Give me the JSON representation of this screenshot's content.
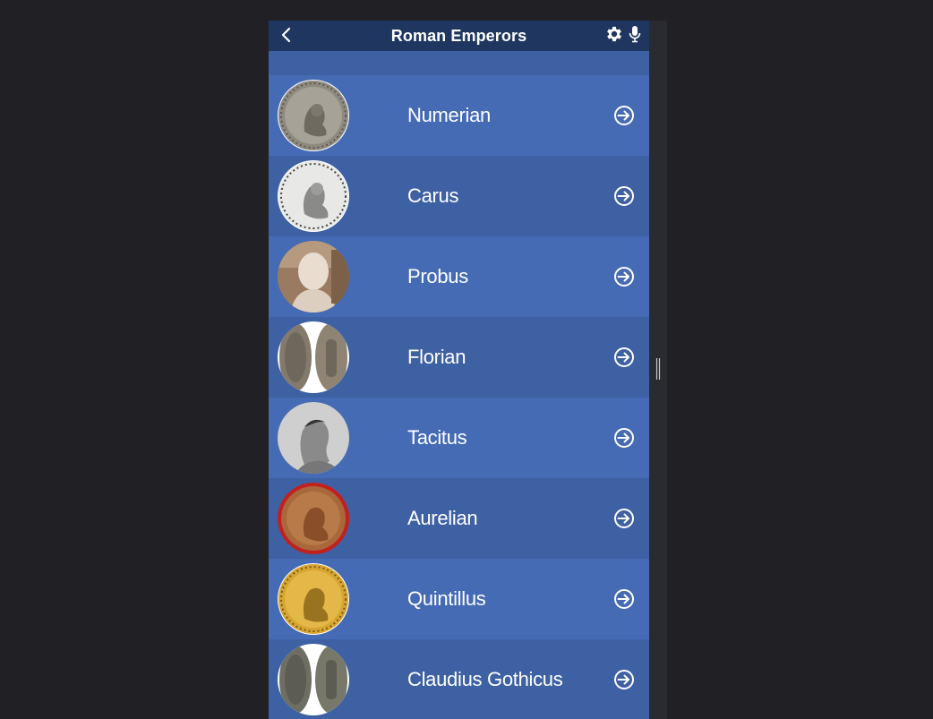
{
  "header": {
    "title": "Roman Emperors",
    "back_icon": "chevron-left-icon",
    "settings_icon": "gear-icon",
    "mic_icon": "microphone-icon"
  },
  "emperors": [
    {
      "name": "Numerian",
      "image": "coin-silver"
    },
    {
      "name": "Carus",
      "image": "coin-white"
    },
    {
      "name": "Probus",
      "image": "marble-bust"
    },
    {
      "name": "Florian",
      "image": "coin-pair"
    },
    {
      "name": "Tacitus",
      "image": "engraving-portrait"
    },
    {
      "name": "Aurelian",
      "image": "coin-bronze"
    },
    {
      "name": "Quintillus",
      "image": "coin-gold"
    },
    {
      "name": "Claudius Gothicus",
      "image": "coin-pair-dark"
    }
  ],
  "row_action_icon": "arrow-right-circle-icon",
  "colors": {
    "header_bg": "#1f3660",
    "row_light": "#456bb4",
    "row_dark": "#3e61a4",
    "page_bg": "#212125",
    "text": "#ffffff"
  }
}
